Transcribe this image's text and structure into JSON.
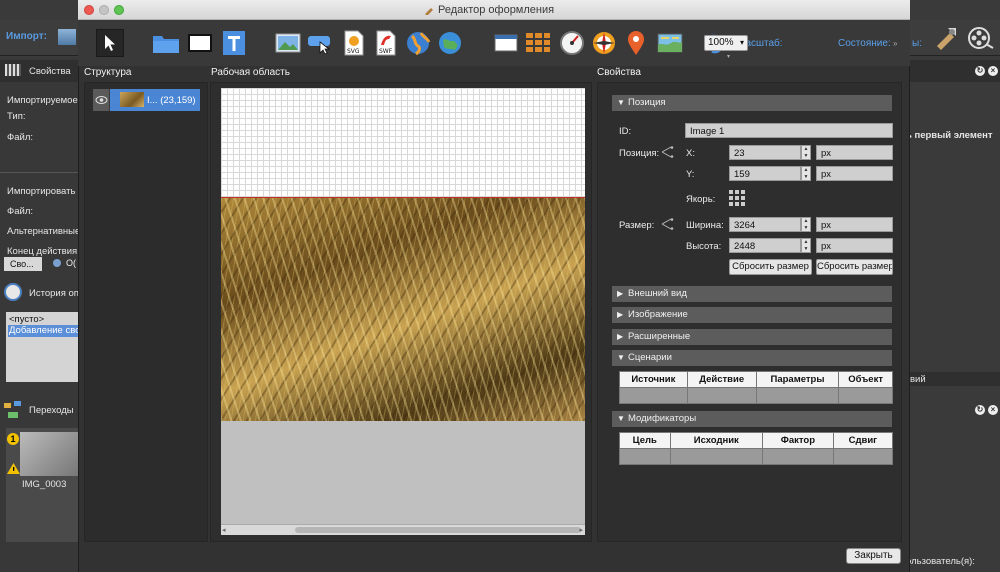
{
  "background_app": {
    "import_label": "Импорт:",
    "properties_tab": "Свойства",
    "fields": [
      "Импортируемое",
      "Тип:",
      "Файл:",
      "Импортировать",
      "Файл:",
      "Альтернативные",
      "Конец действия"
    ],
    "tab_props": "Сво...",
    "tab_other": "О(",
    "history_title": "История оп",
    "history_empty": "<пусто>",
    "history_item": "Добавление сво",
    "transitions_title": "Переходы",
    "transition_item": "IMG_0003",
    "right_text_1": "ь первый элемент",
    "right_text_2": "вий",
    "right_text_3": "ользователь(я):",
    "state_dots": "ы:"
  },
  "dialog": {
    "title": "Редактор оформления",
    "toolbar": {
      "tools": [
        "pointer-tool",
        "folder-tool",
        "rectangle-tool",
        "text-tool",
        "image-tool",
        "button-tool",
        "svg-tool",
        "swf-tool",
        "globe-tool",
        "map-globe-tool",
        "window-tool",
        "grid-tool",
        "gauge-tool",
        "compass-tool",
        "map-pin-tool",
        "map-tool",
        "undo-tool"
      ],
      "svg_label": "SVG",
      "swf_label": "SWF",
      "zoom_label": "Масштаб:",
      "zoom_value": "100%",
      "state_label": "Состояние:"
    },
    "structure": {
      "title": "Структура",
      "item_label": "I... (23,159)"
    },
    "workarea": {
      "title": "Рабочая область"
    },
    "properties": {
      "title": "Свойства",
      "position_group": "Позиция",
      "id_label": "ID:",
      "id_value": "Image 1",
      "position_label": "Позиция:",
      "x_label": "X:",
      "x_value": "23",
      "x_unit": "px",
      "y_label": "Y:",
      "y_value": "159",
      "y_unit": "px",
      "anchor_label": "Якорь:",
      "size_label": "Размер:",
      "width_label": "Ширина:",
      "width_value": "3264",
      "width_unit": "px",
      "height_label": "Высота:",
      "height_value": "2448",
      "height_unit": "px",
      "reset_size_1": "Сбросить размер",
      "reset_size_2": "Сбросить размер",
      "groups": [
        "Внешний вид",
        "Изображение",
        "Расширенные"
      ],
      "scenarios_group": "Сценарии",
      "scenarios_columns": [
        "Источник",
        "Действие",
        "Параметры",
        "Объект"
      ],
      "modifiers_group": "Модификаторы",
      "modifiers_columns": [
        "Цель",
        "Исходник",
        "Фактор",
        "Сдвиг"
      ]
    },
    "close_button": "Закрыть"
  }
}
